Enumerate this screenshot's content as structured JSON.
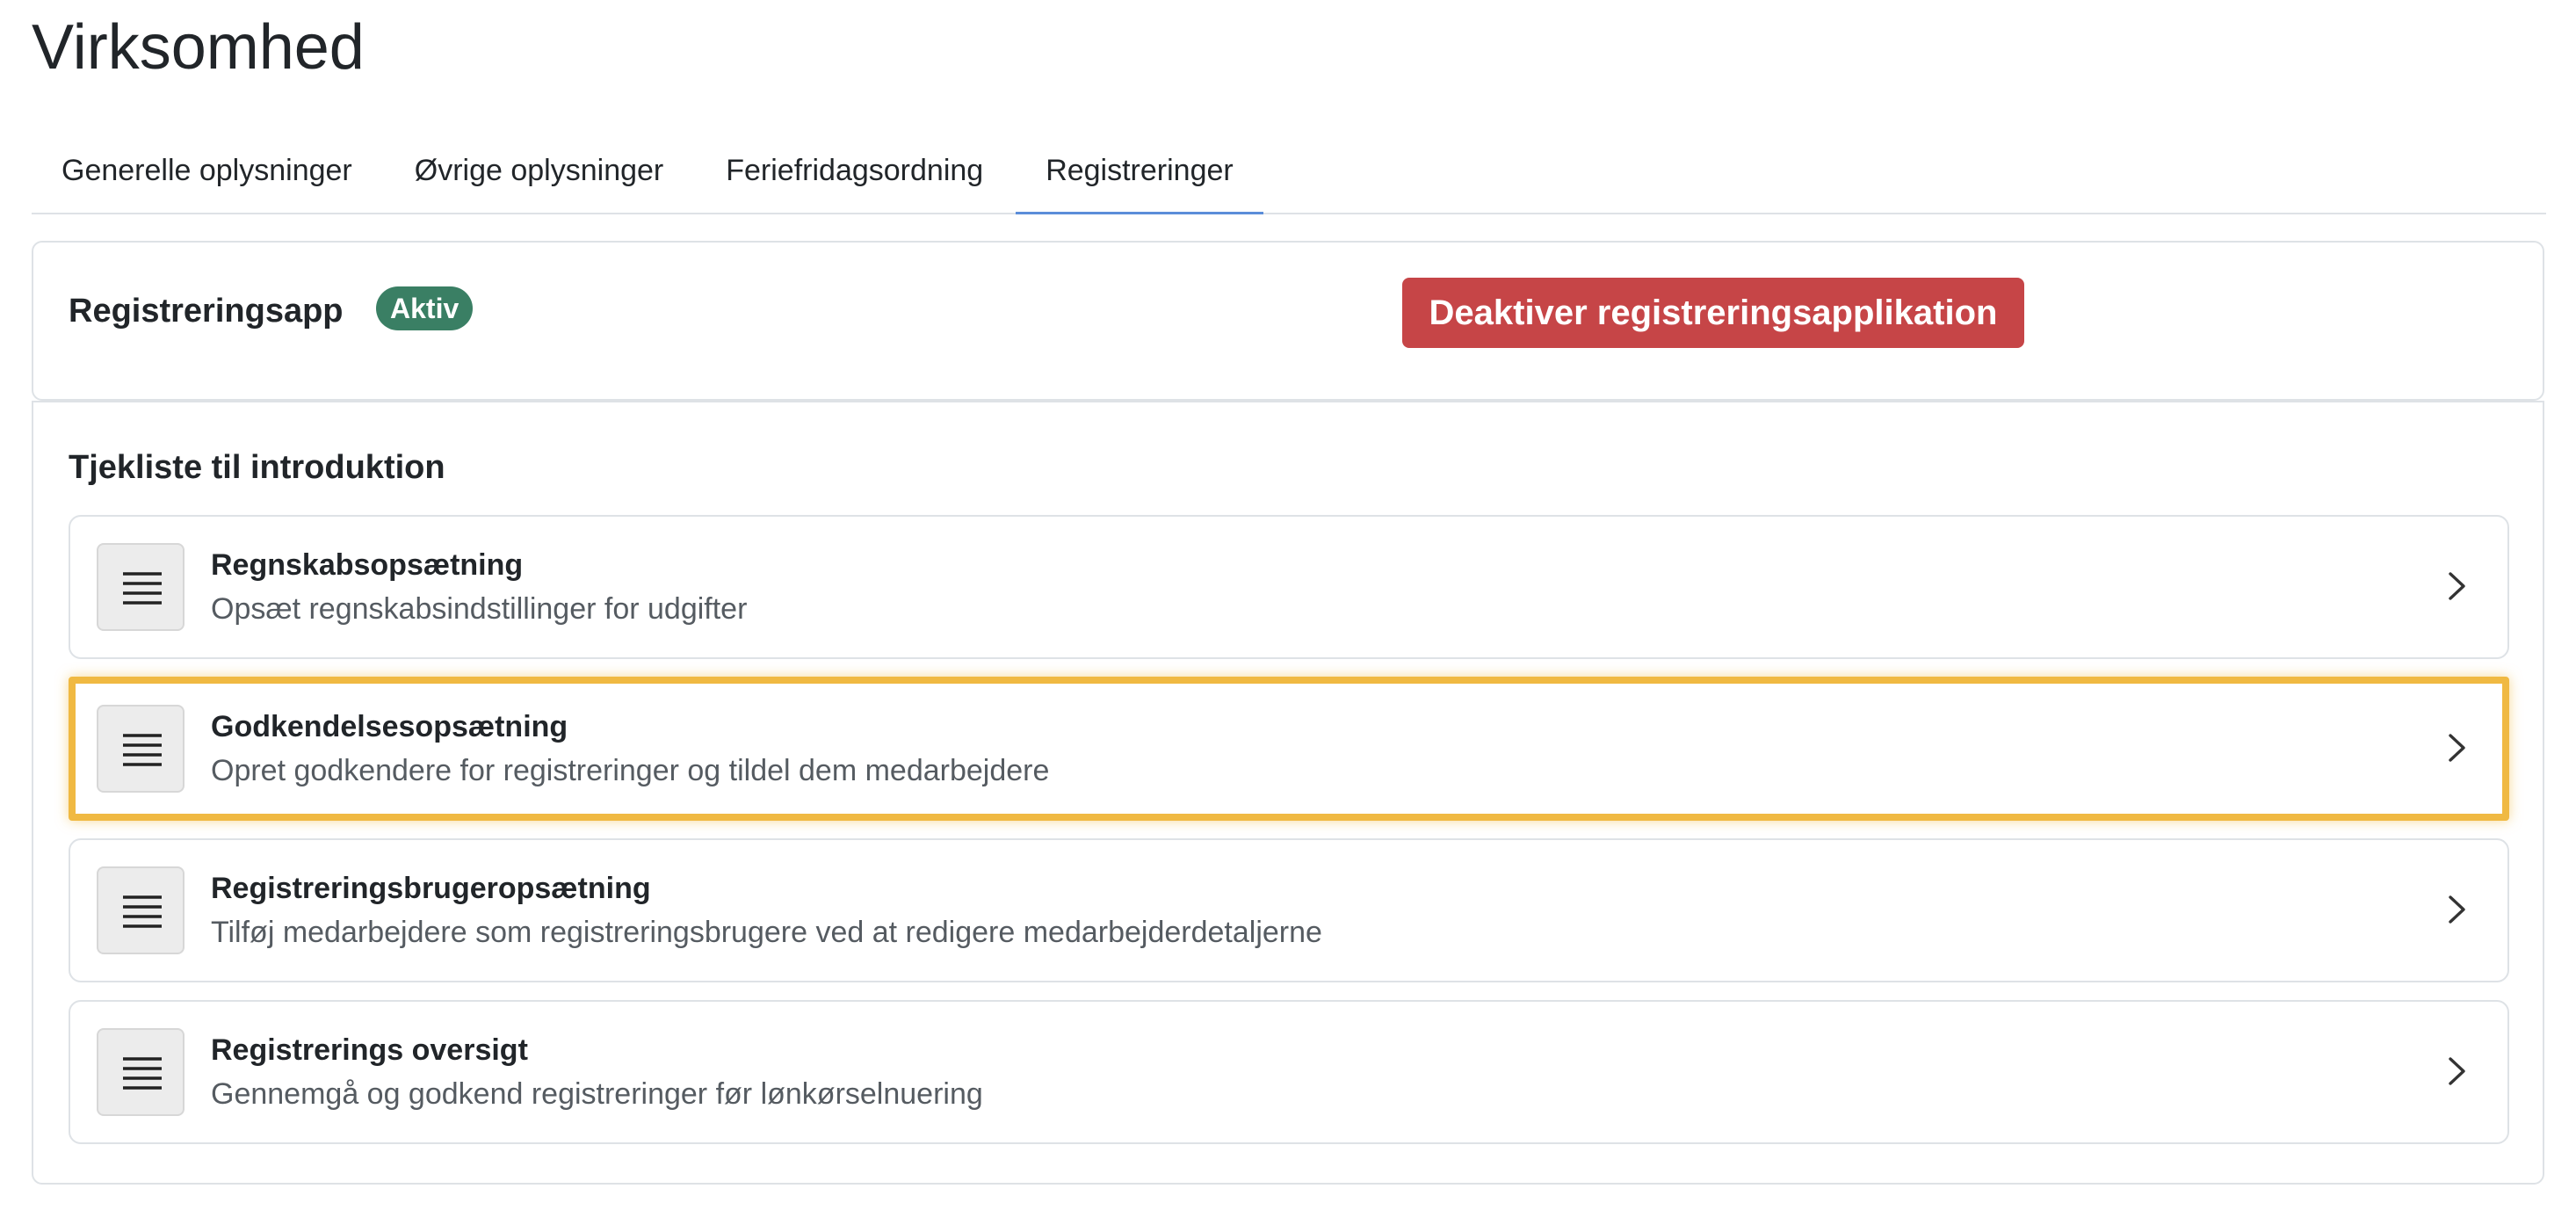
{
  "page": {
    "title": "Virksomhed"
  },
  "tabs": [
    {
      "label": "Generelle oplysninger",
      "active": false
    },
    {
      "label": "Øvrige oplysninger",
      "active": false
    },
    {
      "label": "Feriefridagsordning",
      "active": false
    },
    {
      "label": "Registreringer",
      "active": true
    }
  ],
  "registration_app": {
    "title": "Registreringsapp",
    "status_badge": "Aktiv",
    "deactivate_button": "Deaktiver registreringsapplikation"
  },
  "checklist": {
    "title": "Tjekliste til introduktion",
    "items": [
      {
        "title": "Regnskabsopsætning",
        "description": "Opsæt regnskabsindstillinger for udgifter",
        "icon": "list-icon",
        "highlighted": false
      },
      {
        "title": "Godkendelsesopsætning",
        "description": "Opret godkendere for registreringer og tildel dem medarbejdere",
        "icon": "list-icon",
        "highlighted": true
      },
      {
        "title": "Registreringsbrugeropsætning",
        "description": "Tilføj medarbejdere som registreringsbrugere ved at redigere medarbejderdetaljerne",
        "icon": "list-icon",
        "highlighted": false
      },
      {
        "title": "Registrerings oversigt",
        "description": "Gennemgå og godkend registreringer før lønkørselnuering",
        "icon": "list-icon",
        "highlighted": false
      }
    ]
  },
  "colors": {
    "active_badge": "#3a7f64",
    "danger_button": "#c64547",
    "highlight_border": "#f0b942",
    "active_tab_underline": "#5b8dd9"
  }
}
